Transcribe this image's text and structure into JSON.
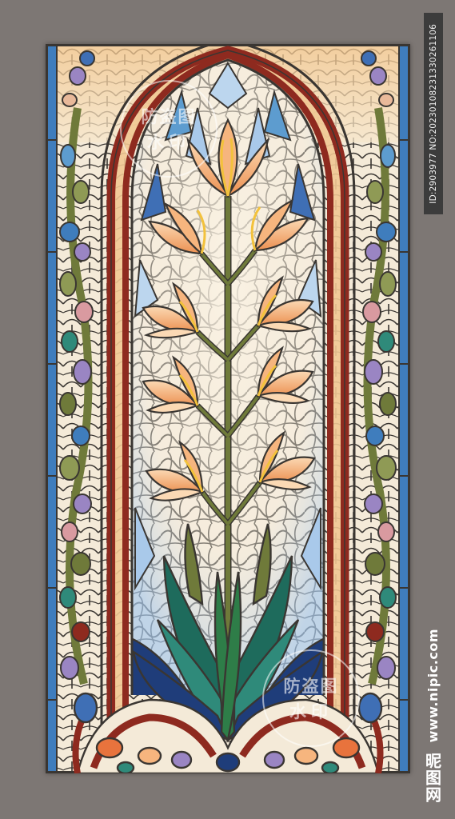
{
  "image": {
    "subject": "stained-glass-window-lilies",
    "id_label": "ID:2903977 NO:20230108231330261106",
    "site_url": "www.nipic.com",
    "site_logo": "昵图网",
    "watermark_line1": "防盗图",
    "watermark_line2": "水印"
  },
  "palette": {
    "background": "#7d7774",
    "lead": "#3a3632",
    "arch_red": "#8e2a1f",
    "border_blue": "#3f7dbd",
    "glass_cream": "#f7efe0",
    "glass_blue": "#bcd6ee",
    "petal_orange": "#f0a064",
    "petal_light": "#fbd9b4",
    "stamen_yellow": "#f3c23c",
    "stem_green": "#6f7a3a",
    "leaf_teal": "#1e6b5c",
    "leaf_navy": "#1f3d7a",
    "accent_purple": "#9a85c3",
    "accent_pink": "#d99aa0"
  }
}
